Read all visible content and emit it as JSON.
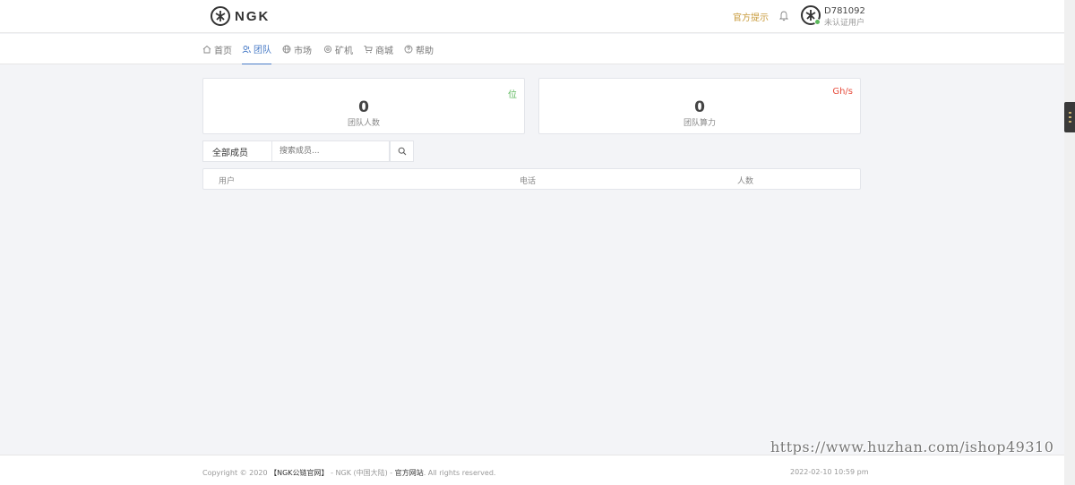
{
  "header": {
    "brand": "NGK",
    "notice_link": "官方提示",
    "user": {
      "id": "D781092",
      "status": "未认证用户"
    }
  },
  "nav": {
    "items": [
      {
        "label": "首页",
        "icon": "home-icon"
      },
      {
        "label": "团队",
        "icon": "users-icon",
        "active": true
      },
      {
        "label": "市场",
        "icon": "globe-icon"
      },
      {
        "label": "矿机",
        "icon": "gear-icon"
      },
      {
        "label": "商城",
        "icon": "cart-icon"
      },
      {
        "label": "帮助",
        "icon": "help-icon"
      }
    ]
  },
  "stats": [
    {
      "value": "0",
      "label": "团队人数",
      "unit": "位",
      "unit_color": "#5cb85c"
    },
    {
      "value": "0",
      "label": "团队算力",
      "unit": "Gh/s",
      "unit_color": "#e74c3c"
    }
  ],
  "search": {
    "filter_label": "全部成员",
    "placeholder": "搜索成员..."
  },
  "table": {
    "columns": [
      "用户",
      "电话",
      "人数"
    ]
  },
  "watermark": "https://www.huzhan.com/ishop49310",
  "footer": {
    "copyright_prefix": "Copyright © 2020",
    "brand_name": "【NGK公链官网】",
    "middle": " - NGK (中国大陆) - ",
    "site": "官方网站",
    "suffix": ". All rights reserved.",
    "datetime": "2022-02-10 10:59 pm"
  }
}
